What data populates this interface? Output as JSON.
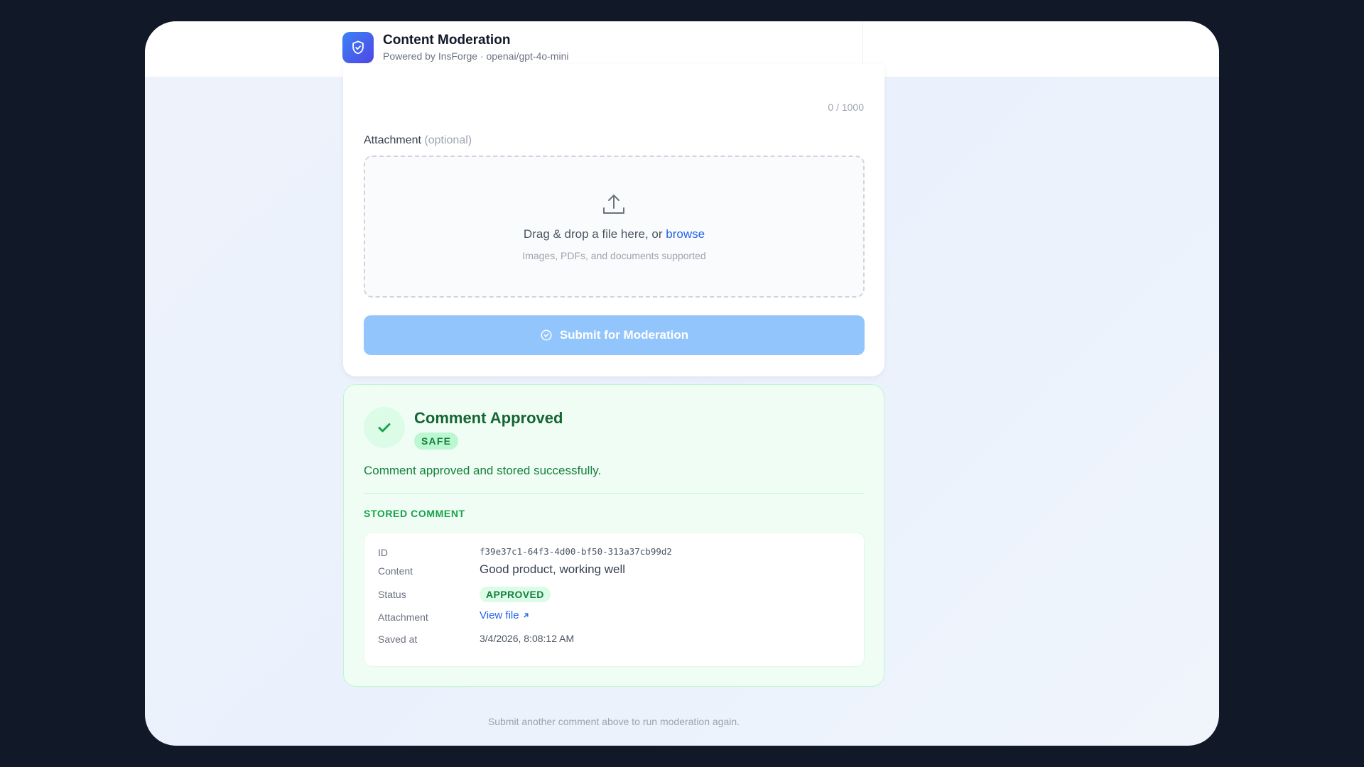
{
  "header": {
    "title": "Content Moderation",
    "subtitle": "Powered by InsForge · openai/gpt-4o-mini",
    "logo_icon": "shield-check-icon"
  },
  "form": {
    "char_counter": "0 / 1000",
    "attachment_label": "Attachment",
    "attachment_optional": "(optional)",
    "dropzone_text": "Drag & drop a file here, or",
    "dropzone_browse": "browse",
    "dropzone_hint": "Images, PDFs, and documents supported",
    "upload_icon": "upload-icon",
    "submit_label": "Submit for Moderation",
    "submit_icon": "check-circle-icon"
  },
  "result": {
    "title": "Comment Approved",
    "badge": "SAFE",
    "message": "Comment approved and stored successfully.",
    "stored_heading": "STORED COMMENT",
    "fields": {
      "id_label": "ID",
      "id_value": "f39e37c1-64f3-4d00-bf50-313a37cb99d2",
      "content_label": "Content",
      "content_value": "Good product, working well",
      "status_label": "Status",
      "status_value": "APPROVED",
      "attachment_label": "Attachment",
      "attachment_link": "View file",
      "saved_label": "Saved at",
      "saved_value": "3/4/2026, 8:08:12 AM"
    }
  },
  "footer_note": "Submit another comment above to run moderation again.",
  "colors": {
    "accent": "#2563eb",
    "success": "#15803d",
    "submit_disabled": "#93c5fd",
    "backdrop": "#111827"
  }
}
